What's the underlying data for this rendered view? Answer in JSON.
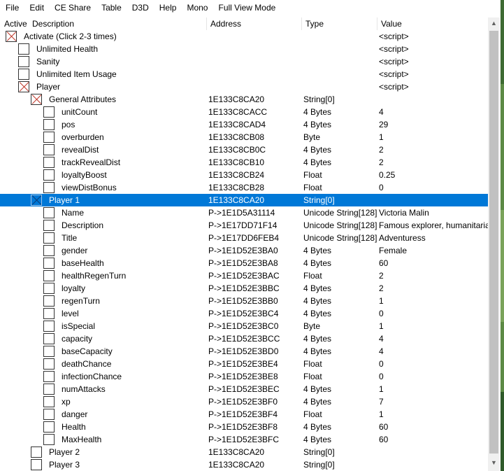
{
  "menu": [
    "File",
    "Edit",
    "CE Share",
    "Table",
    "D3D",
    "Help",
    "Mono",
    "Full View Mode"
  ],
  "columns": {
    "active": "Active",
    "description": "Description",
    "address": "Address",
    "type": "Type",
    "value": "Value"
  },
  "rows": [
    {
      "desc": "Activate (Click 2-3 times)",
      "addr": "",
      "type": "",
      "value": "<script>",
      "indent": 0,
      "checked": true,
      "selected": false
    },
    {
      "desc": "Unlimited Health",
      "addr": "",
      "type": "",
      "value": "<script>",
      "indent": 1,
      "checked": false,
      "selected": false
    },
    {
      "desc": "Sanity",
      "addr": "",
      "type": "",
      "value": "<script>",
      "indent": 1,
      "checked": false,
      "selected": false
    },
    {
      "desc": "Unlimited Item Usage",
      "addr": "",
      "type": "",
      "value": "<script>",
      "indent": 1,
      "checked": false,
      "selected": false
    },
    {
      "desc": "Player",
      "addr": "",
      "type": "",
      "value": "<script>",
      "indent": 1,
      "checked": true,
      "selected": false
    },
    {
      "desc": "General Attributes",
      "addr": "1E133C8CA20",
      "type": "String[0]",
      "value": "",
      "indent": 2,
      "checked": true,
      "selected": false
    },
    {
      "desc": "unitCount",
      "addr": "1E133C8CACC",
      "type": "4 Bytes",
      "value": "4",
      "indent": 3,
      "checked": false,
      "selected": false
    },
    {
      "desc": "pos",
      "addr": "1E133C8CAD4",
      "type": "4 Bytes",
      "value": "29",
      "indent": 3,
      "checked": false,
      "selected": false
    },
    {
      "desc": "overburden",
      "addr": "1E133C8CB08",
      "type": "Byte",
      "value": "1",
      "indent": 3,
      "checked": false,
      "selected": false
    },
    {
      "desc": "revealDist",
      "addr": "1E133C8CB0C",
      "type": "4 Bytes",
      "value": "2",
      "indent": 3,
      "checked": false,
      "selected": false
    },
    {
      "desc": "trackRevealDist",
      "addr": "1E133C8CB10",
      "type": "4 Bytes",
      "value": "2",
      "indent": 3,
      "checked": false,
      "selected": false
    },
    {
      "desc": "loyaltyBoost",
      "addr": "1E133C8CB24",
      "type": "Float",
      "value": "0.25",
      "indent": 3,
      "checked": false,
      "selected": false
    },
    {
      "desc": "viewDistBonus",
      "addr": "1E133C8CB28",
      "type": "Float",
      "value": "0",
      "indent": 3,
      "checked": false,
      "selected": false
    },
    {
      "desc": "Player 1",
      "addr": "1E133C8CA20",
      "type": "String[0]",
      "value": "",
      "indent": 2,
      "checked": true,
      "selected": true
    },
    {
      "desc": "Name",
      "addr": "P->1E1D5A31114",
      "type": "Unicode String[128]",
      "value": "Victoria Malin",
      "indent": 3,
      "checked": false,
      "selected": false
    },
    {
      "desc": "Description",
      "addr": "P->1E17DD71F14",
      "type": "Unicode String[128]",
      "value": "Famous explorer, humanitaria",
      "indent": 3,
      "checked": false,
      "selected": false
    },
    {
      "desc": "Title",
      "addr": "P->1E17DD6FEB4",
      "type": "Unicode String[128]",
      "value": "Adventuress",
      "indent": 3,
      "checked": false,
      "selected": false
    },
    {
      "desc": "gender",
      "addr": "P->1E1D52E3BA0",
      "type": "4 Bytes",
      "value": "Female",
      "indent": 3,
      "checked": false,
      "selected": false
    },
    {
      "desc": "baseHealth",
      "addr": "P->1E1D52E3BA8",
      "type": "4 Bytes",
      "value": "60",
      "indent": 3,
      "checked": false,
      "selected": false
    },
    {
      "desc": "healthRegenTurn",
      "addr": "P->1E1D52E3BAC",
      "type": "Float",
      "value": "2",
      "indent": 3,
      "checked": false,
      "selected": false
    },
    {
      "desc": "loyalty",
      "addr": "P->1E1D52E3BBC",
      "type": "4 Bytes",
      "value": "2",
      "indent": 3,
      "checked": false,
      "selected": false
    },
    {
      "desc": "regenTurn",
      "addr": "P->1E1D52E3BB0",
      "type": "4 Bytes",
      "value": "1",
      "indent": 3,
      "checked": false,
      "selected": false
    },
    {
      "desc": "level",
      "addr": "P->1E1D52E3BC4",
      "type": "4 Bytes",
      "value": "0",
      "indent": 3,
      "checked": false,
      "selected": false
    },
    {
      "desc": "isSpecial",
      "addr": "P->1E1D52E3BC0",
      "type": "Byte",
      "value": "1",
      "indent": 3,
      "checked": false,
      "selected": false
    },
    {
      "desc": "capacity",
      "addr": "P->1E1D52E3BCC",
      "type": "4 Bytes",
      "value": "4",
      "indent": 3,
      "checked": false,
      "selected": false
    },
    {
      "desc": "baseCapacity",
      "addr": "P->1E1D52E3BD0",
      "type": "4 Bytes",
      "value": "4",
      "indent": 3,
      "checked": false,
      "selected": false
    },
    {
      "desc": "deathChance",
      "addr": "P->1E1D52E3BE4",
      "type": "Float",
      "value": "0",
      "indent": 3,
      "checked": false,
      "selected": false
    },
    {
      "desc": "infectionChance",
      "addr": "P->1E1D52E3BE8",
      "type": "Float",
      "value": "0",
      "indent": 3,
      "checked": false,
      "selected": false
    },
    {
      "desc": "numAttacks",
      "addr": "P->1E1D52E3BEC",
      "type": "4 Bytes",
      "value": "1",
      "indent": 3,
      "checked": false,
      "selected": false
    },
    {
      "desc": "xp",
      "addr": "P->1E1D52E3BF0",
      "type": "4 Bytes",
      "value": "7",
      "indent": 3,
      "checked": false,
      "selected": false
    },
    {
      "desc": "danger",
      "addr": "P->1E1D52E3BF4",
      "type": "Float",
      "value": "1",
      "indent": 3,
      "checked": false,
      "selected": false
    },
    {
      "desc": "Health",
      "addr": "P->1E1D52E3BF8",
      "type": "4 Bytes",
      "value": "60",
      "indent": 3,
      "checked": false,
      "selected": false
    },
    {
      "desc": "MaxHealth",
      "addr": "P->1E1D52E3BFC",
      "type": "4 Bytes",
      "value": "60",
      "indent": 3,
      "checked": false,
      "selected": false
    },
    {
      "desc": "Player 2",
      "addr": "1E133C8CA20",
      "type": "String[0]",
      "value": "",
      "indent": 2,
      "checked": false,
      "selected": false
    },
    {
      "desc": "Player 3",
      "addr": "1E133C8CA20",
      "type": "String[0]",
      "value": "",
      "indent": 2,
      "checked": false,
      "selected": false
    }
  ],
  "scrollbar": {
    "up_icon": "arrow-up-icon",
    "down_icon": "arrow-down-icon"
  }
}
